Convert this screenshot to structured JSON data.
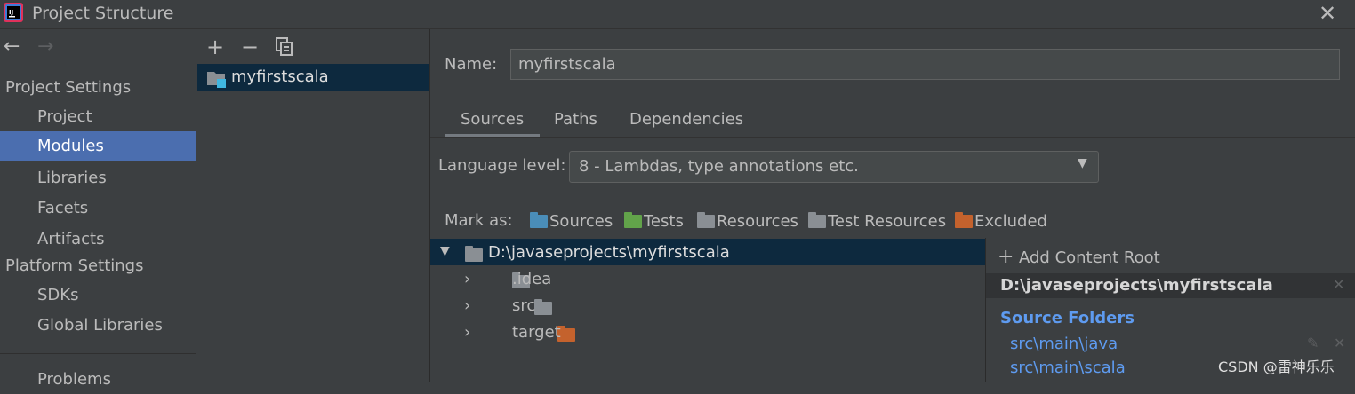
{
  "window": {
    "title": "Project Structure",
    "close_glyph": "✕",
    "app_icon": "intellij-idea-icon"
  },
  "nav": {
    "back": "←",
    "forward": "→",
    "project_settings_header": "Project Settings",
    "project_settings_items": [
      "Project",
      "Modules",
      "Libraries",
      "Facets",
      "Artifacts"
    ],
    "selected": "Modules",
    "platform_settings_header": "Platform Settings",
    "platform_settings_items": [
      "SDKs",
      "Global Libraries"
    ],
    "problems": "Problems"
  },
  "modules_toolbar": {
    "add": "+",
    "remove": "−",
    "copy_icon": "copy-icon"
  },
  "modules": [
    {
      "name": "myfirstscala"
    }
  ],
  "name_field": {
    "label": "Name:",
    "value": "myfirstscala"
  },
  "tabs": [
    "Sources",
    "Paths",
    "Dependencies"
  ],
  "active_tab": "Sources",
  "language_level": {
    "label": "Language level:",
    "value": "8 - Lambdas, type annotations etc."
  },
  "mark_as": {
    "label": "Mark as:",
    "items": [
      {
        "label": "Sources",
        "color": "#4a8db8"
      },
      {
        "label": "Tests",
        "color": "#62a34a"
      },
      {
        "label": "Resources",
        "color": "#8a8f94"
      },
      {
        "label": "Test Resources",
        "color": "#8a8f94"
      },
      {
        "label": "Excluded",
        "color": "#c4622d"
      }
    ]
  },
  "tree": {
    "root": "D:\\javaseprojects\\myfirstscala",
    "children": [
      {
        "name": ".idea",
        "color": "#8a8f94"
      },
      {
        "name": "src",
        "color": "#8a8f94"
      },
      {
        "name": "target",
        "color": "#c4622d"
      }
    ]
  },
  "content_root": {
    "add_label": "Add Content Root",
    "path": "D:\\javaseprojects\\myfirstscala",
    "source_folders_header": "Source Folders",
    "source_folders": [
      "src\\main\\java",
      "src\\main\\scala"
    ]
  },
  "watermark": "CSDN @雷神乐乐"
}
